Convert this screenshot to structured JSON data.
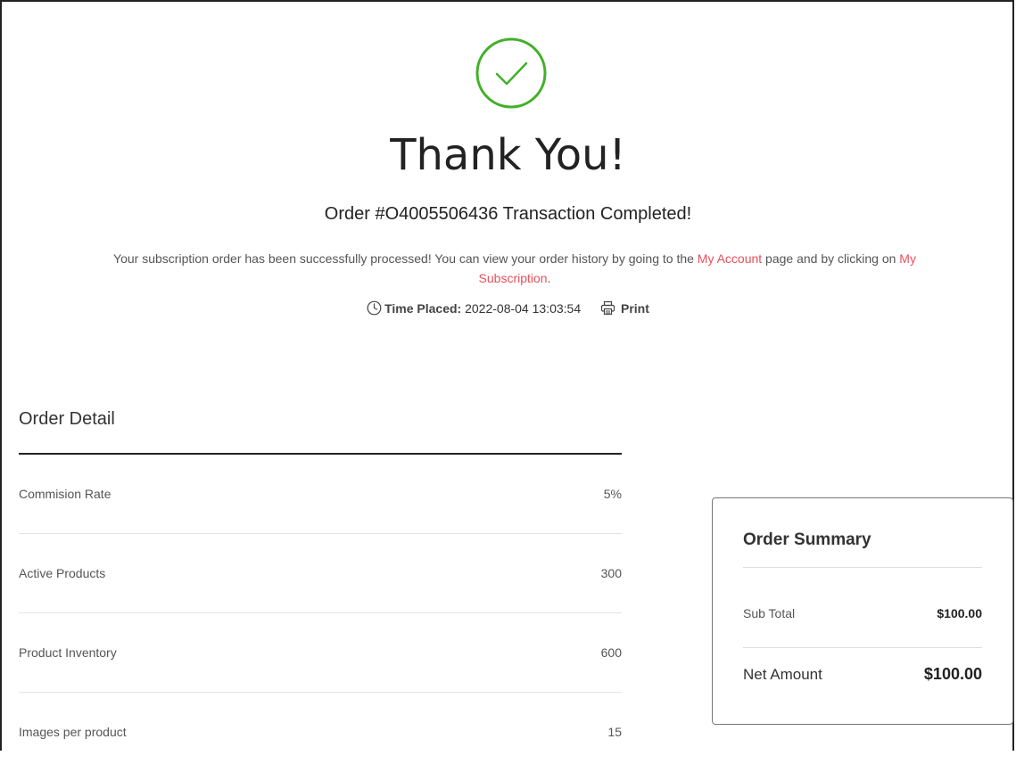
{
  "header": {
    "icon": "check-circle-icon",
    "success_color": "#43b02a",
    "title": "Thank You!",
    "order_prefix": "Order #",
    "order_number": "O4005506436",
    "order_suffix": " Transaction Completed!"
  },
  "message": {
    "part1": "Your subscription order has been successfully processed! You can view your order history by going to the ",
    "link1": "My Account",
    "part2": " page and by clicking on ",
    "link2": "My Subscription",
    "part3": ".",
    "link_color": "#e8505b"
  },
  "meta": {
    "time_label": "Time Placed:",
    "time_value": "2022-08-04 13:03:54",
    "print_label": "Print"
  },
  "order_detail": {
    "title": "Order Detail",
    "rows": [
      {
        "label": "Commision Rate",
        "value": "5%"
      },
      {
        "label": "Active Products",
        "value": "300"
      },
      {
        "label": "Product Inventory",
        "value": "600"
      },
      {
        "label": "Images per product",
        "value": "15"
      }
    ]
  },
  "order_summary": {
    "title": "Order Summary",
    "sub_total_label": "Sub Total",
    "sub_total_value": "$100.00",
    "net_amount_label": "Net Amount",
    "net_amount_value": "$100.00"
  }
}
